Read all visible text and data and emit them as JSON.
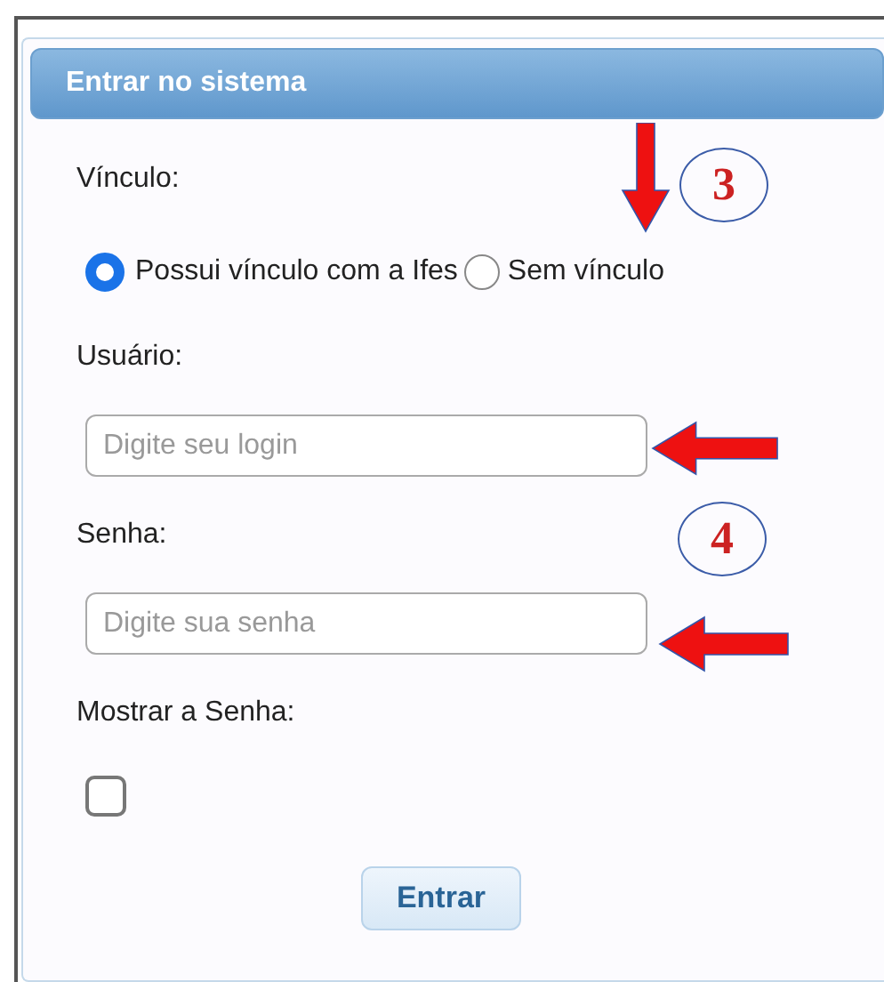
{
  "panel": {
    "title": "Entrar no sistema"
  },
  "vinculo": {
    "label": "Vínculo:",
    "options": [
      {
        "label": "Possui vínculo com a Ifes",
        "selected": true
      },
      {
        "label": "Sem vínculo",
        "selected": false
      }
    ]
  },
  "usuario": {
    "label": "Usuário:",
    "placeholder": "Digite seu login"
  },
  "senha": {
    "label": "Senha:",
    "placeholder": "Digite sua senha"
  },
  "mostrar_senha": {
    "label": "Mostrar a Senha:",
    "checked": false
  },
  "submit_button": "Entrar",
  "annotations": [
    {
      "kind": "down_arrow"
    },
    {
      "kind": "number",
      "label": "3"
    },
    {
      "kind": "left_arrow"
    },
    {
      "kind": "number",
      "label": "4"
    },
    {
      "kind": "left_arrow"
    }
  ]
}
